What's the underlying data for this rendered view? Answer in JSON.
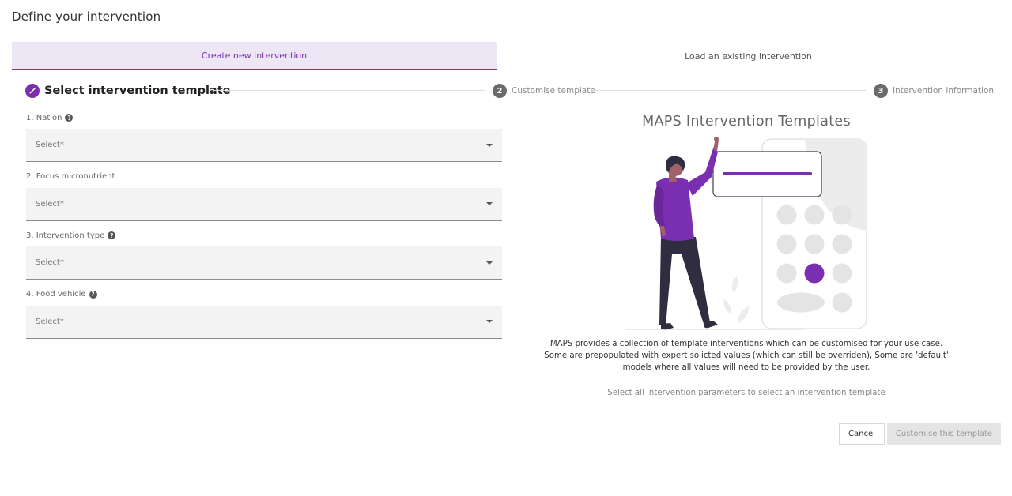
{
  "dialog": {
    "title": "Define your intervention"
  },
  "tabs": [
    {
      "label": "Create new intervention",
      "active": true
    },
    {
      "label": "Load an existing intervention",
      "active": false
    }
  ],
  "stepper": {
    "steps": [
      {
        "number": "",
        "icon": "pencil-icon",
        "label": "Select intervention template",
        "active": true
      },
      {
        "number": "2",
        "label": "Customise template",
        "active": false
      },
      {
        "number": "3",
        "label": "Intervention information",
        "active": false
      }
    ]
  },
  "form": {
    "fields": [
      {
        "label": "1. Nation",
        "has_help": true,
        "placeholder": "Select*"
      },
      {
        "label": "2. Focus micronutrient",
        "has_help": false,
        "placeholder": "Select*"
      },
      {
        "label": "3. Intervention type",
        "has_help": true,
        "placeholder": "Select*"
      },
      {
        "label": "4. Food vehicle",
        "has_help": true,
        "placeholder": "Select*"
      }
    ]
  },
  "panel": {
    "title": "MAPS Intervention Templates",
    "description": "MAPS provides a collection of template interventions which can be customised for your use case. Some are prepopulated with expert solicted values (which can still be overriden), Some are 'default' models where all values will need to be provided by the user.",
    "hint": "Select all intervention parameters to select an intervention template"
  },
  "actions": {
    "cancel_label": "Cancel",
    "primary_label": "Customise this template",
    "primary_disabled": true
  },
  "colors": {
    "accent": "#7a2fb0",
    "tab_active_bg": "#ede6f4"
  }
}
